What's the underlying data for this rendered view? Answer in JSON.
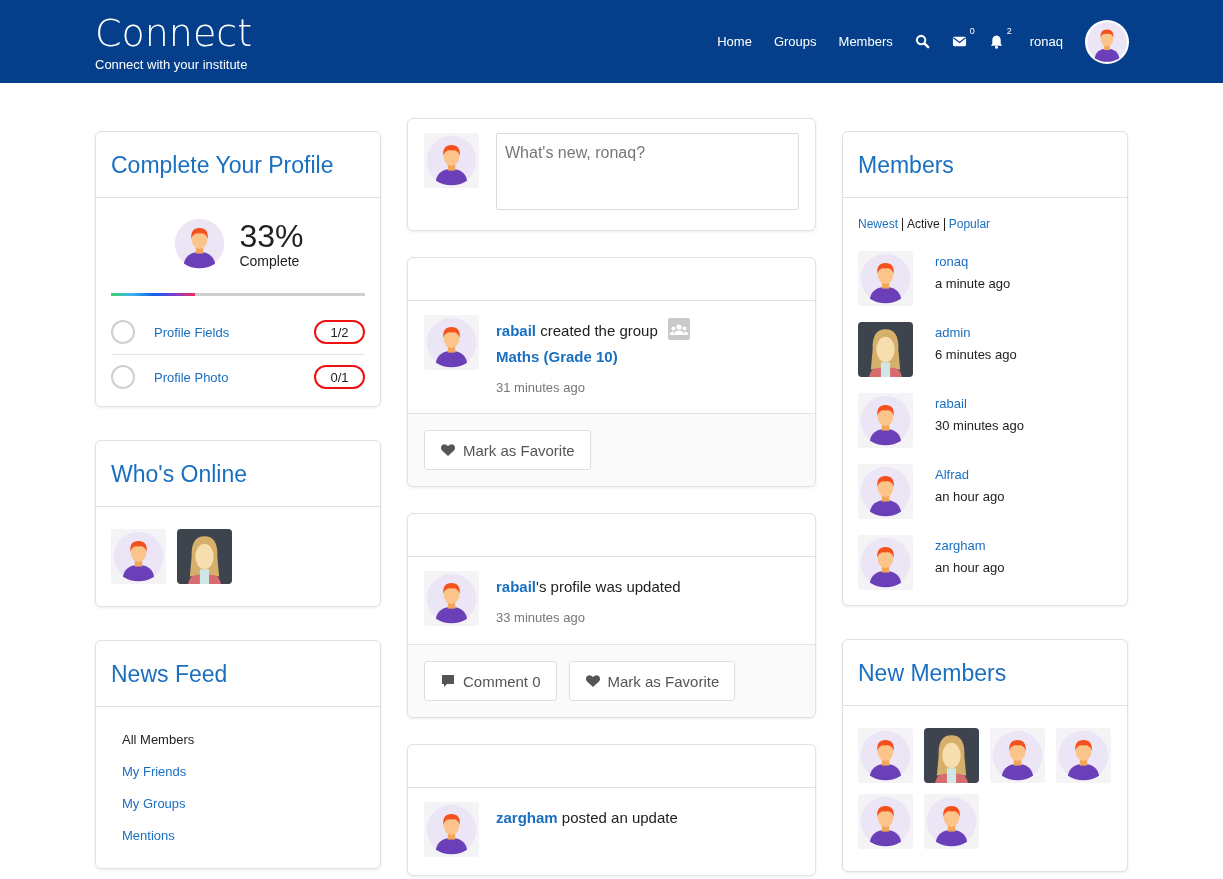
{
  "header": {
    "title": "Connect",
    "tagline": "Connect with your institute",
    "nav": [
      "Home",
      "Groups",
      "Members"
    ],
    "mail_count": "0",
    "notification_count": "2",
    "user": "ronaq",
    "avatar": {
      "kind": "boy"
    }
  },
  "profile_card": {
    "title": "Complete Your Profile",
    "avatar": {
      "kind": "boy"
    },
    "percent": "33%",
    "caption": "Complete",
    "level": 0.33,
    "items": [
      {
        "label": "Profile Fields",
        "count": "1/2",
        "checked": false
      },
      {
        "label": "Profile Photo",
        "count": "0/1",
        "checked": false
      }
    ]
  },
  "whos_online": {
    "title": "Who's Online",
    "avatars": [
      {
        "kind": "boy"
      },
      {
        "kind": "girl"
      }
    ]
  },
  "news_feed": {
    "title": "News Feed",
    "items": [
      {
        "label": "All Members",
        "selected": true
      },
      {
        "label": "My Friends",
        "selected": false
      },
      {
        "label": "My Groups",
        "selected": false
      },
      {
        "label": "Mentions",
        "selected": false
      }
    ]
  },
  "post_box": {
    "avatar": {
      "kind": "boy"
    },
    "placeholder": "What's new, ronaq?"
  },
  "activities": [
    {
      "avatar": {
        "kind": "boy"
      },
      "actor": "rabail",
      "action": " created the group",
      "group": "Maths (Grade 10)",
      "time": "31 minutes ago",
      "buttons": [
        {
          "kind": "favorite",
          "label": "Mark as Favorite"
        }
      ]
    },
    {
      "avatar": {
        "kind": "boy"
      },
      "actor": "rabail",
      "action": "'s profile was updated",
      "time": "33 minutes ago",
      "buttons": [
        {
          "kind": "comment",
          "label": "Comment 0"
        },
        {
          "kind": "favorite",
          "label": "Mark as Favorite"
        }
      ]
    },
    {
      "avatar": {
        "kind": "boy"
      },
      "actor": "zargham",
      "action": " posted an update"
    }
  ],
  "members": {
    "title": "Members",
    "filters": [
      {
        "label": "Newest",
        "selected": false
      },
      {
        "label": "Active",
        "selected": true
      },
      {
        "label": "Popular",
        "selected": false
      }
    ],
    "items": [
      {
        "name": "ronaq",
        "time": "a minute ago",
        "avatar": {
          "kind": "boy"
        }
      },
      {
        "name": "admin",
        "time": "6 minutes ago",
        "avatar": {
          "kind": "girl"
        }
      },
      {
        "name": "rabail",
        "time": "30 minutes ago",
        "avatar": {
          "kind": "boy"
        }
      },
      {
        "name": "Alfrad",
        "time": "an hour ago",
        "avatar": {
          "kind": "boy"
        }
      },
      {
        "name": "zargham",
        "time": "an hour ago",
        "avatar": {
          "kind": "boy"
        }
      }
    ]
  },
  "new_members": {
    "title": "New Members",
    "avatars": [
      {
        "kind": "boy"
      },
      {
        "kind": "girl"
      },
      {
        "kind": "boy"
      },
      {
        "kind": "boy"
      },
      {
        "kind": "boy"
      },
      {
        "kind": "boy"
      }
    ]
  }
}
